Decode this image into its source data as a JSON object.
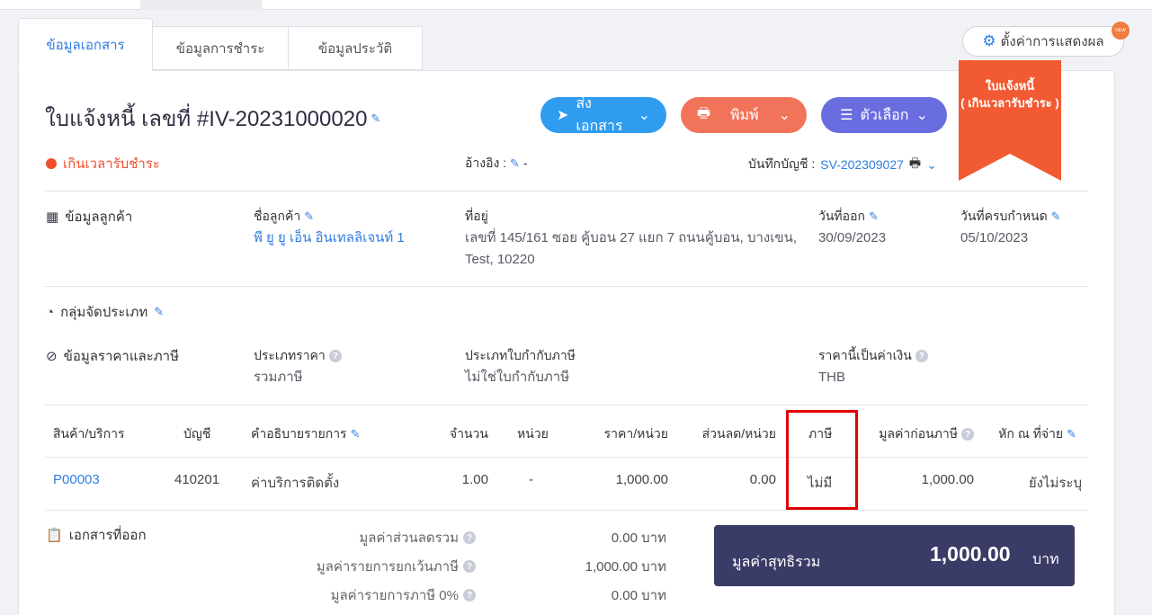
{
  "tabs": [
    {
      "label": "ข้อมูลเอกสาร"
    },
    {
      "label": "ข้อมูลการชำระ"
    },
    {
      "label": "ข้อมูลประวัติ"
    }
  ],
  "settings": {
    "label": "ตั้งค่าการแสดงผล",
    "badge": "NEW"
  },
  "ribbon": {
    "title": "ใบแจ้งหนี้",
    "subtitle": "( เกินเวลารับชำระ )"
  },
  "header": {
    "title": "ใบแจ้งหนี้ เลขที่ #IV-20231000020",
    "send_label": "ส่งเอกสาร",
    "print_label": "พิมพ์",
    "options_label": "ตัวเลือก",
    "status": "เกินเวลารับชำระ",
    "ref_label": "อ้างอิง :",
    "ref_value": "-",
    "account_label": "บันทึกบัญชี :",
    "account_value": "SV-202309027"
  },
  "customer": {
    "section_title": "ข้อมูลลูกค้า",
    "name_label": "ชื่อลูกค้า",
    "name_value": "พี ยู ยู เอ็น อินเทลลิเจนท์ 1",
    "address_label": "ที่อยู่",
    "address_line1": "เลขที่ 145/161 ซอย คู้บอน 27 แยก 7 ถนนคู้บอน, บางเขน,",
    "address_line2": "Test, 10220",
    "issue_label": "วันที่ออก",
    "issue_value": "30/09/2023",
    "due_label": "วันที่ครบกำหนด",
    "due_value": "05/10/2023"
  },
  "category": {
    "section_title": "กลุ่มจัดประเภท"
  },
  "pricing": {
    "section_title": "ข้อมูลราคาและภาษี",
    "price_type_label": "ประเภทราคา",
    "price_type_value": "รวมภาษี",
    "tax_invoice_label": "ประเภทใบกำกับภาษี",
    "tax_invoice_value": "ไม่ใช่ใบกำกับภาษี",
    "currency_label": "ราคานี้เป็นค่าเงิน",
    "currency_value": "THB"
  },
  "table": {
    "headers": [
      "สินค้า/บริการ",
      "บัญชี",
      "คำอธิบายรายการ",
      "จำนวน",
      "หน่วย",
      "ราคา/หน่วย",
      "ส่วนลด/หน่วย",
      "ภาษี",
      "มูลค่าก่อนภาษี",
      "หัก ณ ที่จ่าย"
    ],
    "row": {
      "product": "P00003",
      "account": "410201",
      "description": "ค่าบริการติดตั้ง",
      "qty": "1.00",
      "unit": "-",
      "price": "1,000.00",
      "discount": "0.00",
      "tax": "ไม่มี",
      "pretax": "1,000.00",
      "withholding": "ยังไม่ระบุ"
    }
  },
  "issued_docs": {
    "section_title": "เอกสารที่ออก"
  },
  "summary": [
    {
      "label": "มูลค่าส่วนลดรวม",
      "value": "0.00 บาท"
    },
    {
      "label": "มูลค่ารายการยกเว้นภาษี",
      "value": "1,000.00 บาท"
    },
    {
      "label": "มูลค่ารายการภาษี 0%",
      "value": "0.00 บาท"
    }
  ],
  "net": {
    "label": "มูลค่าสุทธิรวม",
    "value": "1,000.00",
    "unit": "บาท"
  },
  "colors": {
    "primary": "#2f7de1",
    "overdue": "#ef4f2f",
    "highlight": "#e00000",
    "net_box": "#3a3b66"
  }
}
